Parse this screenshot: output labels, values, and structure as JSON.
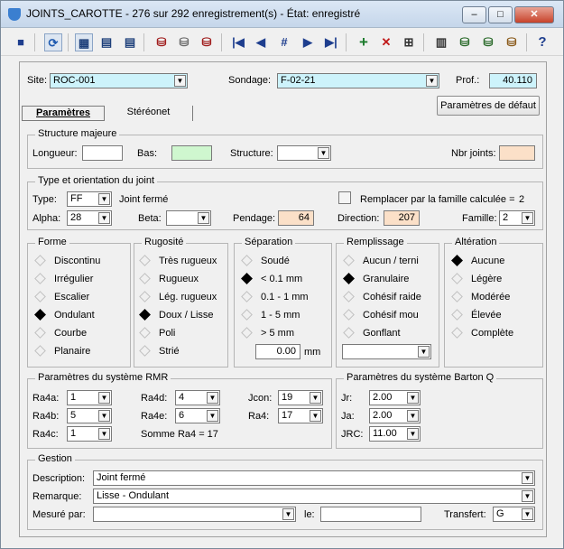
{
  "window": {
    "title": "JOINTS_CAROTTE - 276 sur 292 enregistrement(s) - État: enregistré",
    "minimize": "–",
    "maximize": "□",
    "close": "✕"
  },
  "toolbar": {
    "icons": [
      "save-icon",
      "refresh-icon",
      "form-view-icon",
      "table-view-icon",
      "list-view-icon",
      "delete-db-icon",
      "copy-db-icon",
      "delete-record-db-icon",
      "first-record-icon",
      "prev-record-icon",
      "goto-record-icon",
      "next-record-icon",
      "last-record-icon",
      "add-record-icon",
      "delete-record-icon",
      "tree-icon",
      "book-icon",
      "db-stack-icon",
      "db-stack2-icon",
      "db-doc-icon",
      "help-icon"
    ],
    "glyphs": [
      "■",
      "⟳",
      "▦",
      "▤",
      "▤",
      "⛁",
      "⛁",
      "⛁",
      "|◀",
      "◀",
      "#",
      "▶",
      "▶|",
      "+",
      "✕",
      "⊞",
      "▥",
      "⛁",
      "⛁",
      "⛁",
      "?"
    ]
  },
  "header": {
    "site_label": "Site:",
    "site_value": "ROC-001",
    "sondage_label": "Sondage:",
    "sondage_value": "F-02-21",
    "prof_label": "Prof.:",
    "prof_value": "40.110",
    "default_button": "Paramètres de défaut"
  },
  "tabs": [
    "Paramètres",
    "Stéréonet"
  ],
  "structure": {
    "title": "Structure majeure",
    "longueur_label": "Longueur:",
    "longueur_value": "",
    "bas_label": "Bas:",
    "bas_value": "",
    "structure_label": "Structure:",
    "structure_value": "",
    "nbr_label": "Nbr joints:",
    "nbr_value": ""
  },
  "type_joint": {
    "title": "Type et orientation du joint",
    "type_label": "Type:",
    "type_value": "FF",
    "type_desc": "Joint fermé",
    "replace_label": "Remplacer par la famille calculée =",
    "replace_value": "2",
    "alpha_label": "Alpha:",
    "alpha_value": "28",
    "beta_label": "Beta:",
    "beta_value": "",
    "pendage_label": "Pendage:",
    "pendage_value": "64",
    "direction_label": "Direction:",
    "direction_value": "207",
    "famille_label": "Famille:",
    "famille_value": "2"
  },
  "forme": {
    "title": "Forme",
    "options": [
      "Discontinu",
      "Irrégulier",
      "Escalier",
      "Ondulant",
      "Courbe",
      "Planaire"
    ],
    "selected": 3
  },
  "rugosite": {
    "title": "Rugosité",
    "options": [
      "Très rugueux",
      "Rugueux",
      "Lég. rugueux",
      "Doux / Lisse",
      "Poli",
      "Strié"
    ],
    "selected": 3
  },
  "separation": {
    "title": "Séparation",
    "options": [
      "Soudé",
      "< 0.1 mm",
      "0.1 - 1 mm",
      "1 - 5 mm",
      "> 5 mm"
    ],
    "selected": 1,
    "value": "0.00",
    "unit": "mm"
  },
  "remplissage": {
    "title": "Remplissage",
    "options": [
      "Aucun / terni",
      "Granulaire",
      "Cohésif raide",
      "Cohésif mou",
      "Gonflant"
    ],
    "selected": 1,
    "dropdown_value": ""
  },
  "alteration": {
    "title": "Altération",
    "options": [
      "Aucune",
      "Légère",
      "Modérée",
      "Élevée",
      "Complète"
    ],
    "selected": 0
  },
  "rmr": {
    "title": "Paramètres du système RMR",
    "ra4a_label": "Ra4a:",
    "ra4a_value": "1",
    "ra4b_label": "Ra4b:",
    "ra4b_value": "5",
    "ra4c_label": "Ra4c:",
    "ra4c_value": "1",
    "ra4d_label": "Ra4d:",
    "ra4d_value": "4",
    "ra4e_label": "Ra4e:",
    "ra4e_value": "6",
    "somme": "Somme Ra4 = 17",
    "jcon_label": "Jcon:",
    "jcon_value": "19",
    "ra4_label": "Ra4:",
    "ra4_value": "17"
  },
  "barton": {
    "title": "Paramètres du système Barton Q",
    "jr_label": "Jr:",
    "jr_value": "2.00",
    "ja_label": "Ja:",
    "ja_value": "2.00",
    "jrc_label": "JRC:",
    "jrc_value": "11.00"
  },
  "gestion": {
    "title": "Gestion",
    "description_label": "Description:",
    "description_value": "Joint fermé",
    "remarque_label": "Remarque:",
    "remarque_value": "Lisse - Ondulant",
    "mesure_label": "Mesuré par:",
    "mesure_value": "",
    "le_label": "le:",
    "le_value": "",
    "transfert_label": "Transfert:",
    "transfert_value": "G"
  }
}
